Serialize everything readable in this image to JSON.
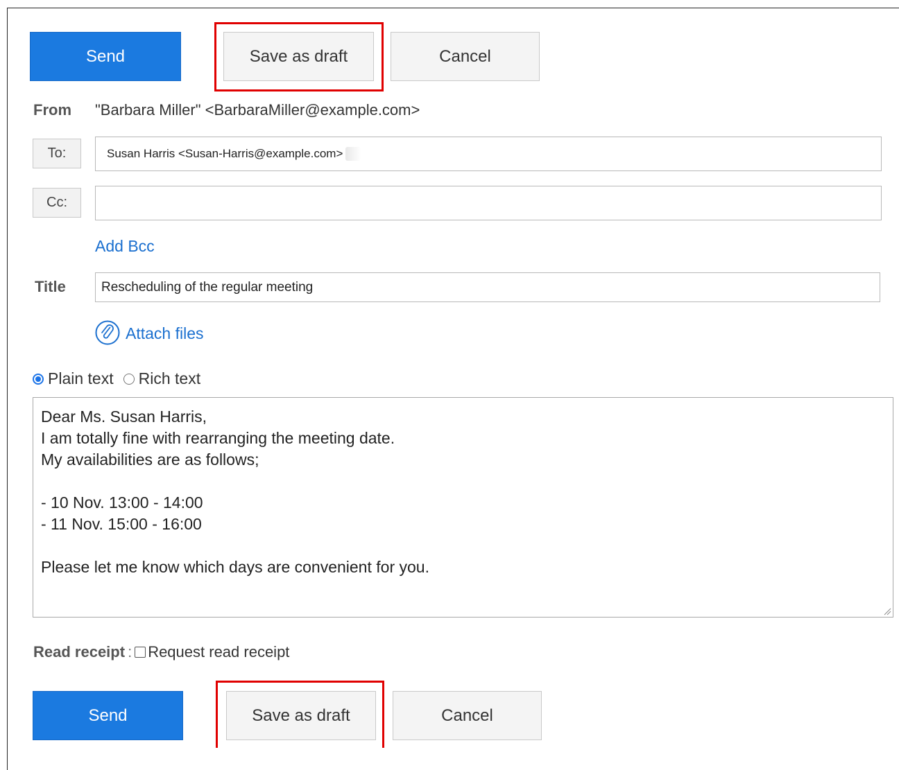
{
  "toolbar_top": {
    "send_label": "Send",
    "save_draft_label": "Save as draft",
    "cancel_label": "Cancel"
  },
  "from": {
    "label": "From",
    "value": "\"Barbara Miller\" <BarbaraMiller@example.com>"
  },
  "to": {
    "button_label": "To:",
    "recipient": "Susan Harris <Susan-Harris@example.com>"
  },
  "cc": {
    "button_label": "Cc:",
    "value": ""
  },
  "add_bcc_label": "Add Bcc",
  "title": {
    "label": "Title",
    "value": "Rescheduling of the regular meeting"
  },
  "attach_label": "Attach files",
  "format": {
    "plain_label": "Plain text",
    "rich_label": "Rich text",
    "selected": "Plain text"
  },
  "body": {
    "lines": [
      "Dear Ms. Susan Harris,",
      "I am totally fine with rearranging the meeting date.",
      "My availabilities are as follows;",
      "",
      "- 10 Nov. 13:00 - 14:00",
      "- 11 Nov. 15:00 - 16:00",
      "",
      "Please let me know which days are convenient for you."
    ]
  },
  "read_receipt": {
    "label": "Read receipt",
    "colon": ":",
    "checkbox_label": "Request read receipt",
    "checked": false
  },
  "toolbar_bottom": {
    "send_label": "Send",
    "save_draft_label": "Save as draft",
    "cancel_label": "Cancel"
  },
  "colors": {
    "send_button": "#1b7ae0",
    "highlight": "#e00000",
    "link": "#1a6fcf"
  },
  "icons": {
    "attach": "paperclip-icon"
  }
}
